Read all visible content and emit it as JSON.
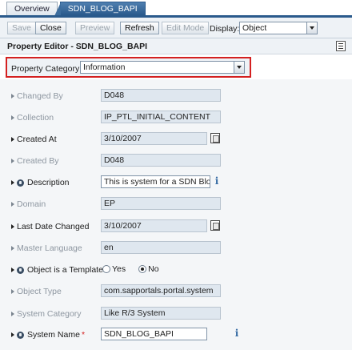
{
  "tabs": [
    {
      "label": "Overview"
    },
    {
      "label": "SDN_BLOG_BAPI"
    }
  ],
  "toolbar": {
    "save_label": "Save",
    "close_label": "Close",
    "preview_label": "Preview",
    "refresh_label": "Refresh",
    "editmode_label": "Edit Mode",
    "display_label": "Display:",
    "display_value": "Object"
  },
  "editor": {
    "title": "Property Editor - SDN_BLOG_BAPI"
  },
  "category": {
    "label": "Property Category:",
    "value": "Information"
  },
  "properties": {
    "changed_by": {
      "label": "Changed By",
      "value": "D048"
    },
    "collection": {
      "label": "Collection",
      "value": "IP_PTL_INITIAL_CONTENT"
    },
    "created_at": {
      "label": "Created At",
      "value": "3/10/2007"
    },
    "created_by": {
      "label": "Created By",
      "value": "D048"
    },
    "description": {
      "label": "Description",
      "value": "This is system for a SDN Blog..."
    },
    "domain": {
      "label": "Domain",
      "value": "EP"
    },
    "last_date_changed": {
      "label": "Last Date Changed",
      "value": "3/10/2007"
    },
    "master_language": {
      "label": "Master Language",
      "value": "en"
    },
    "object_is_template": {
      "label": "Object is a Template",
      "option_yes": "Yes",
      "option_no": "No",
      "selected": "No"
    },
    "object_type": {
      "label": "Object Type",
      "value": "com.sapportals.portal.system"
    },
    "system_category": {
      "label": "System Category",
      "value": "Like R/3 System"
    },
    "system_name": {
      "label": "System Name",
      "required_mark": "*",
      "value": "SDN_BLOG_BAPI"
    }
  }
}
